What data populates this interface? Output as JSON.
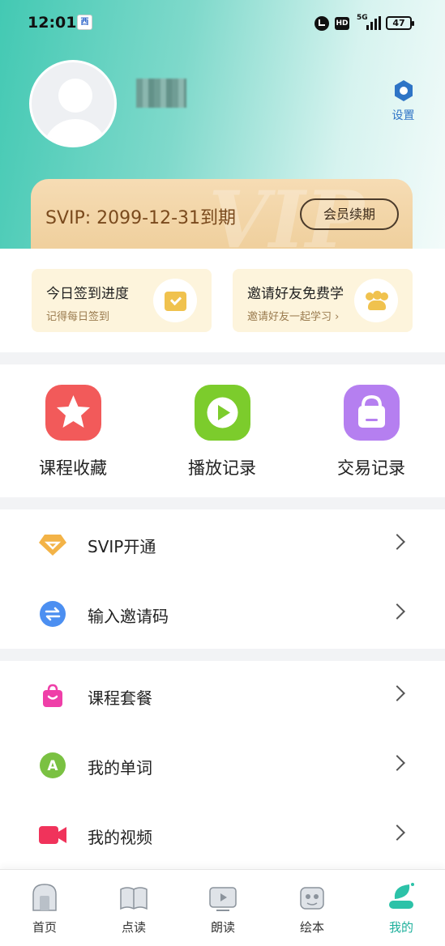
{
  "status_bar": {
    "time": "12:01",
    "app_badge": "西",
    "hd": "HD",
    "network": "5G",
    "battery": "47"
  },
  "profile": {
    "settings_label": "设置"
  },
  "membership": {
    "watermark": "VIP",
    "expiry_text": "SVIP: 2099-12-31到期",
    "renew_button": "会员续期"
  },
  "quick_cards": [
    {
      "title": "今日签到进度",
      "subtitle": "记得每日签到",
      "icon": "calendar-check-icon"
    },
    {
      "title": "邀请好友免费学",
      "subtitle": "邀请好友一起学习 ›",
      "icon": "friends-icon"
    }
  ],
  "shortcuts": [
    {
      "label": "课程收藏",
      "icon": "star-icon",
      "color": "#f25a5a"
    },
    {
      "label": "播放记录",
      "icon": "play-icon",
      "color": "#7ccc2c"
    },
    {
      "label": "交易记录",
      "icon": "bag-icon",
      "color": "#b57ff0"
    }
  ],
  "menu_group_1": [
    {
      "label": "SVIP开通",
      "icon": "diamond-icon"
    },
    {
      "label": "输入邀请码",
      "icon": "exchange-icon"
    }
  ],
  "menu_group_2": [
    {
      "label": "课程套餐",
      "icon": "gift-bag-icon"
    },
    {
      "label": "我的单词",
      "icon": "letter-a-icon"
    },
    {
      "label": "我的视频",
      "icon": "video-camera-icon"
    }
  ],
  "tabs": [
    {
      "label": "首页",
      "icon": "home-icon"
    },
    {
      "label": "点读",
      "icon": "book-icon"
    },
    {
      "label": "朗读",
      "icon": "tv-icon"
    },
    {
      "label": "绘本",
      "icon": "picture-book-icon"
    },
    {
      "label": "我的",
      "icon": "profile-icon",
      "active": true
    }
  ],
  "colors": {
    "accent": "#1eb09c",
    "settings": "#2e74c6",
    "svip_text": "#7a4a1d"
  }
}
